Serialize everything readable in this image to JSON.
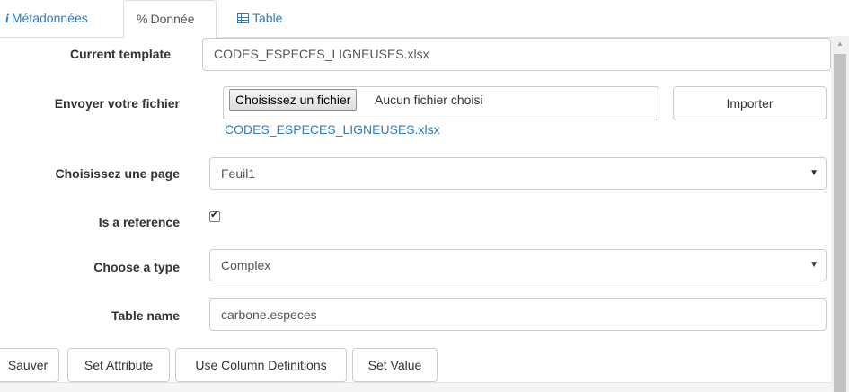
{
  "tabs": [
    {
      "label": "Métadonnées",
      "icon": "info-icon",
      "glyph": "i"
    },
    {
      "label": "Donnée",
      "icon": "link-icon",
      "glyph": "%"
    },
    {
      "label": "Table",
      "icon": "table-icon"
    }
  ],
  "form": {
    "current_template": {
      "label": "Current template",
      "value": "CODES_ESPECES_LIGNEUSES.xlsx"
    },
    "upload": {
      "label": "Envoyer votre fichier",
      "choose_button": "Choisissez un fichier",
      "no_file": "Aucun fichier choisi",
      "import_button": "Importer",
      "file_link": "CODES_ESPECES_LIGNEUSES.xlsx"
    },
    "page": {
      "label": "Choisissez une page",
      "value": "Feuil1"
    },
    "reference": {
      "label": "Is a reference",
      "checked": true
    },
    "type": {
      "label": "Choose a type",
      "value": "Complex"
    },
    "table_name": {
      "label": "Table name",
      "value": "carbone.especes"
    }
  },
  "actions": {
    "save": "Sauver",
    "set_attribute": "Set Attribute",
    "use_column_definitions": "Use Column Definitions",
    "set_value": "Set Value"
  },
  "colors": {
    "link": "#337ab7",
    "border": "#cccccc",
    "text": "#333333"
  },
  "scrollbar": {
    "up_glyph": "▲"
  },
  "caret_glyph": "▼"
}
